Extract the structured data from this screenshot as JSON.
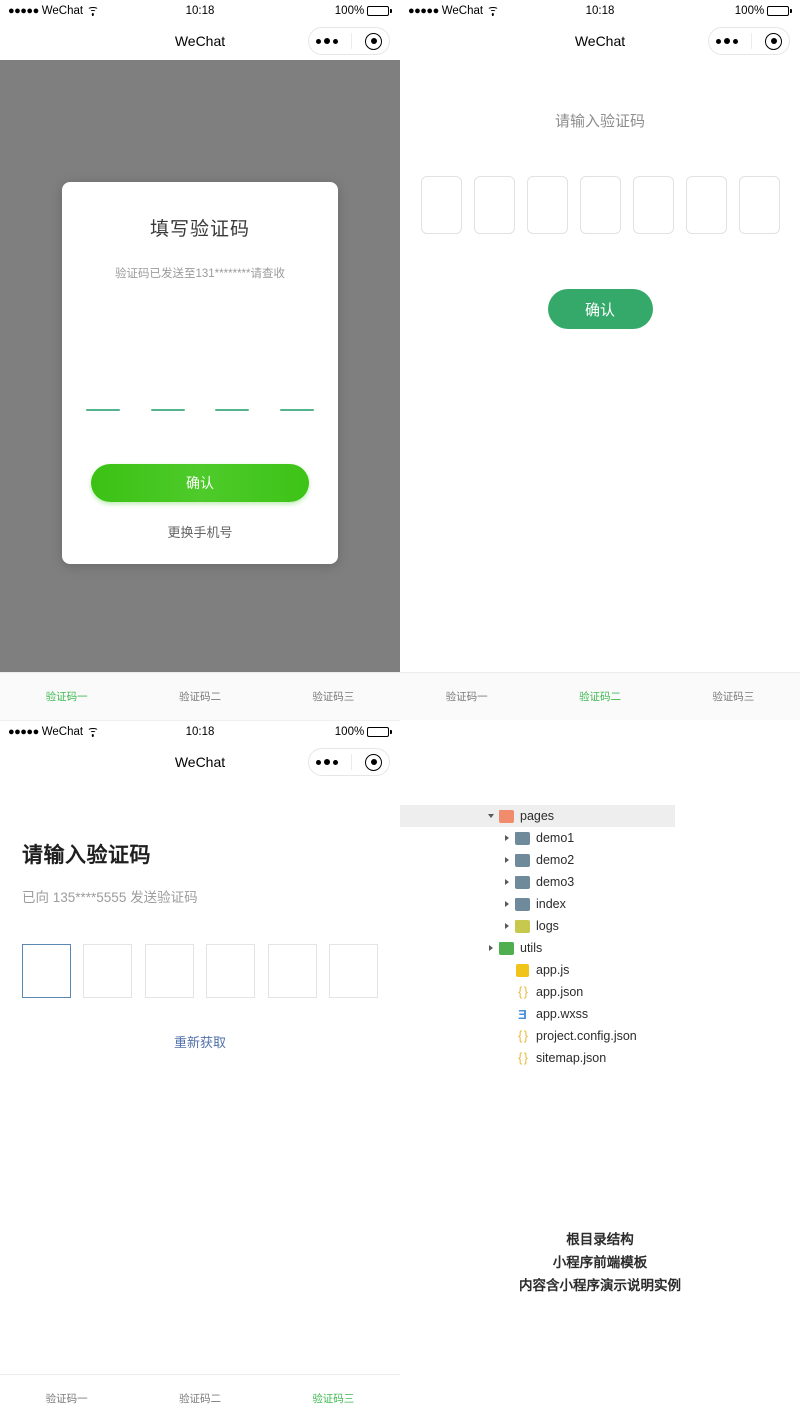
{
  "status_bar": {
    "signal_dots": "●●●●●",
    "carrier": "WeChat",
    "time": "10:18",
    "battery_pct": "100%"
  },
  "nav_bar": {
    "title": "WeChat"
  },
  "panel1": {
    "modal": {
      "title": "填写验证码",
      "subtitle": "验证码已发送至131********请查收",
      "confirm_label": "确认",
      "change_phone_label": "更换手机号",
      "dash_count": 4,
      "accent_color": "#3cc51f",
      "dash_color": "#52b38d"
    },
    "overlay_color": "#7f7f7f"
  },
  "panel2": {
    "title": "请输入验证码",
    "box_count": 7,
    "confirm_label": "确认",
    "button_color": "#35a96a"
  },
  "panel3": {
    "title": "请输入验证码",
    "subtitle": "已向 135****5555 发送验证码",
    "box_count": 6,
    "focused_index": 0,
    "focus_border_color": "#5b87b5",
    "resend_label": "重新获取",
    "link_color": "#5170a8"
  },
  "panel4": {
    "tree": [
      {
        "label": "pages",
        "icon": "folder-red",
        "arrow": "open",
        "indent": 0,
        "selected": true
      },
      {
        "label": "demo1",
        "icon": "folder-blue",
        "arrow": "closed",
        "indent": 1,
        "selected": false
      },
      {
        "label": "demo2",
        "icon": "folder-blue",
        "arrow": "closed",
        "indent": 1,
        "selected": false
      },
      {
        "label": "demo3",
        "icon": "folder-blue",
        "arrow": "closed",
        "indent": 1,
        "selected": false
      },
      {
        "label": "index",
        "icon": "folder-blue",
        "arrow": "closed",
        "indent": 1,
        "selected": false
      },
      {
        "label": "logs",
        "icon": "folder-olive",
        "arrow": "closed",
        "indent": 1,
        "selected": false
      },
      {
        "label": "utils",
        "icon": "folder-green",
        "arrow": "closed",
        "indent": 0,
        "selected": false
      },
      {
        "label": "app.js",
        "icon": "js",
        "arrow": "none",
        "indent": 1,
        "selected": false
      },
      {
        "label": "app.json",
        "icon": "braces",
        "arrow": "none",
        "indent": 1,
        "selected": false
      },
      {
        "label": "app.wxss",
        "icon": "wxss",
        "arrow": "none",
        "indent": 1,
        "selected": false
      },
      {
        "label": "project.config.json",
        "icon": "braces",
        "arrow": "none",
        "indent": 1,
        "selected": false
      },
      {
        "label": "sitemap.json",
        "icon": "braces",
        "arrow": "none",
        "indent": 1,
        "selected": false
      }
    ],
    "caption_lines": [
      "根目录结构",
      "小程序前端模板",
      "内容含小程序演示说明实例"
    ]
  },
  "tabbars": {
    "labels": [
      "验证码一",
      "验证码二",
      "验证码三"
    ],
    "mid_left_active": 0,
    "mid_right_active": 1,
    "bottom_active": 2,
    "active_color": "#3fb950",
    "inactive_color": "#7a7a7a"
  }
}
